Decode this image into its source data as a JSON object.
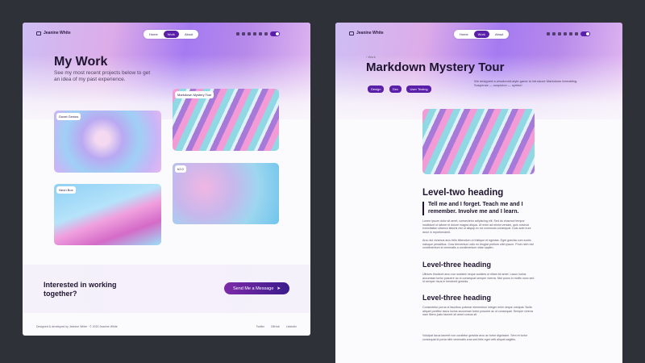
{
  "brand": {
    "name": "Jeanine White"
  },
  "nav": {
    "items": [
      "Home",
      "Work",
      "About"
    ],
    "active": "Work"
  },
  "left": {
    "title": "My Work",
    "subtitle": "See my most recent projects below to get an idea of my past experience.",
    "cards": [
      "Duvet Genius",
      "Markdown Mystery Tour",
      "Neon Box",
      "h2.0"
    ],
    "cta_title": "Interested in working together?",
    "cta_button": "Send Me a Message",
    "footer_left": "Designed & developed by Jeanine White · © 2020 Jeanine White",
    "footer_links": [
      "Twitter",
      "GitHub",
      "LinkedIn"
    ]
  },
  "right": {
    "back": "‹ Work",
    "title": "Markdown Mystery Tour",
    "tags": [
      "Design",
      "Dev",
      "User Testing"
    ],
    "desc": "We designed a whodunnit-style game to introduce Markdown formatting. Suspense — suspicion — syntax!",
    "h2": "Level-two heading",
    "quote": "Tell me and I forget. Teach me and I remember. Involve me and I learn.",
    "p1": "Lorem ipsum dolor sit amet, consectetur adipiscing elit. Sed do eiusmod tempor incididunt ut labore et dolore magna aliqua. Ut enim ad minim veniam, quis nostrud exercitation ullamco laboris nisi ut aliquip ex ea commodo consequat. Duis aute irure dolor in reprehenderit.",
    "p2": "Arcu dui vivamus arcu felis bibendum ut tristique et egestas. Eget gravida cum sociis natoque penatibus. Cras fermentum odio eu feugiat pretium nibh ipsum. Proin nibh nisl condimentum id venenatis a condimentum vitae sapien.",
    "h3a": "Level-three heading",
    "p3": "Ultrices tincidunt arcu non sodales neque sodales ut etiam sit amet. Lacus luctus accumsan tortor posuere ac ut consequat semper viverra. Nisl purus in mollis nunc sed id semper risus in hendrerit gravida.",
    "h3b": "Level-three heading",
    "p4": "Consectetur purus ut faucibus pulvinar elementum integer enim neque volutpat. Nulla aliquet porttitor lacus luctus accumsan tortor posuere ac ut consequat. Semper viverra nam libero justo laoreet sit amet cursus sit.",
    "p5": "Volutpat lacus laoreet non curabitur gravida arcu ac tortor dignissim. Sem et tortor consequat id porta nibh venenatis cras sed felis eget velit aliquet sagittis."
  }
}
